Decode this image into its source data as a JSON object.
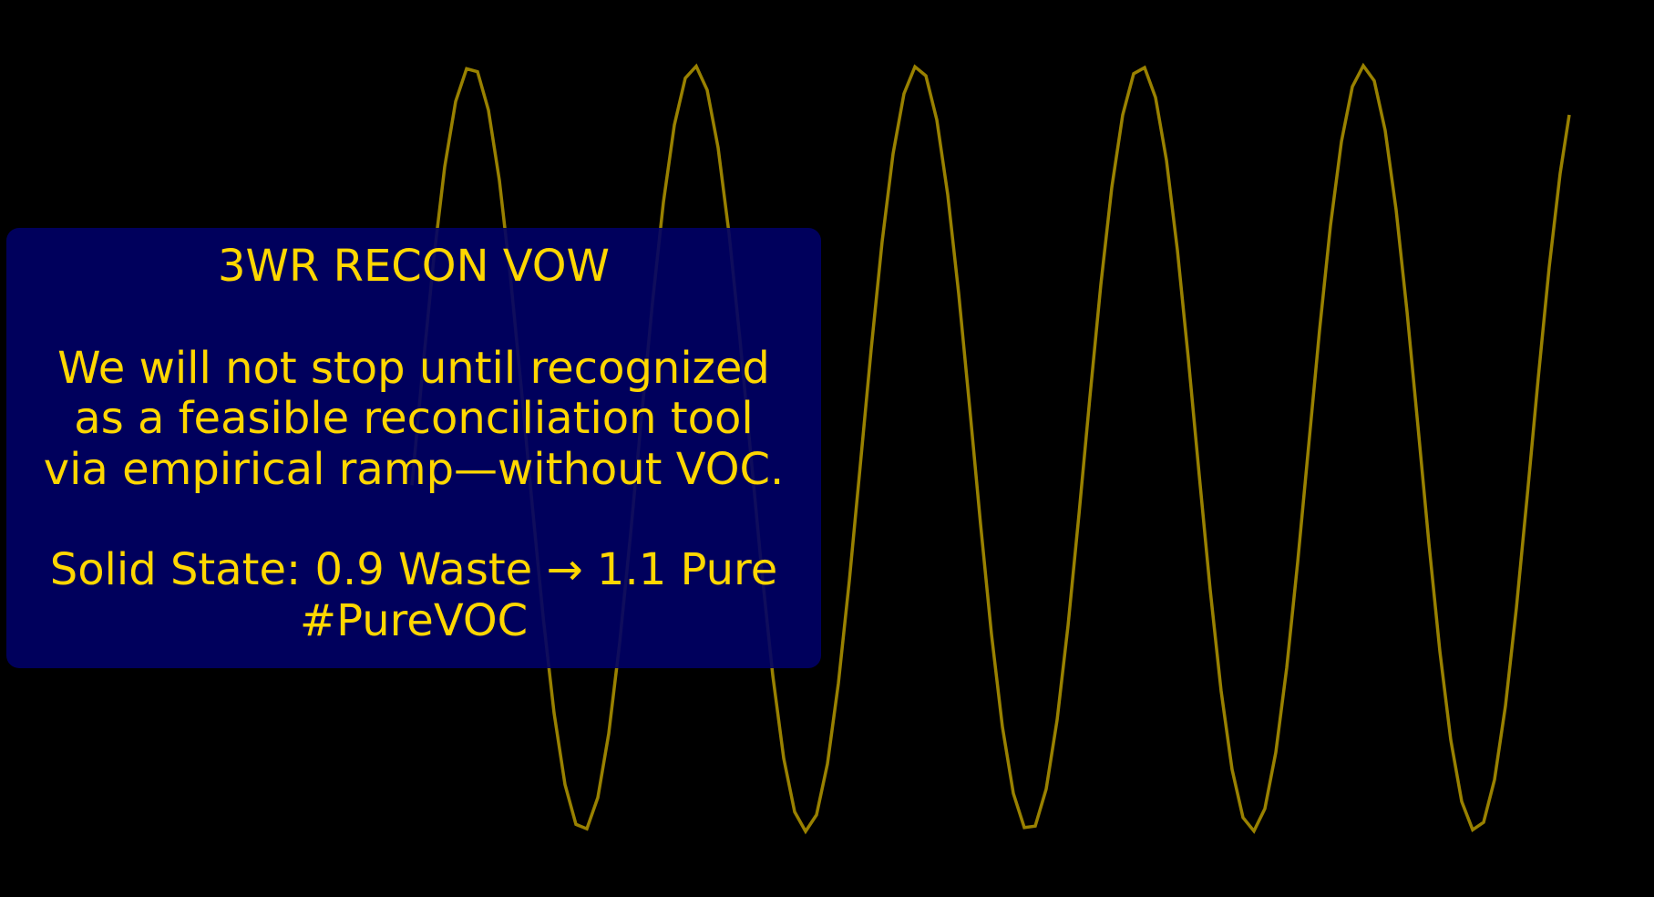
{
  "colors": {
    "background": "#000000",
    "panel": "#000066",
    "text": "#FFD700",
    "wave": "#FFD700"
  },
  "wave": {
    "cycles": 6,
    "amplitude_label": "",
    "description_shape": "sine"
  },
  "vow": {
    "title": "3WR RECON VOW",
    "body_lines": [
      "We will not stop until recognized",
      "as a feasible reconciliation tool",
      "via empirical ramp—without VOC."
    ],
    "footer_lines": [
      "Solid State: 0.9 Waste → 1.1 Pure",
      "#PureVOC"
    ]
  }
}
